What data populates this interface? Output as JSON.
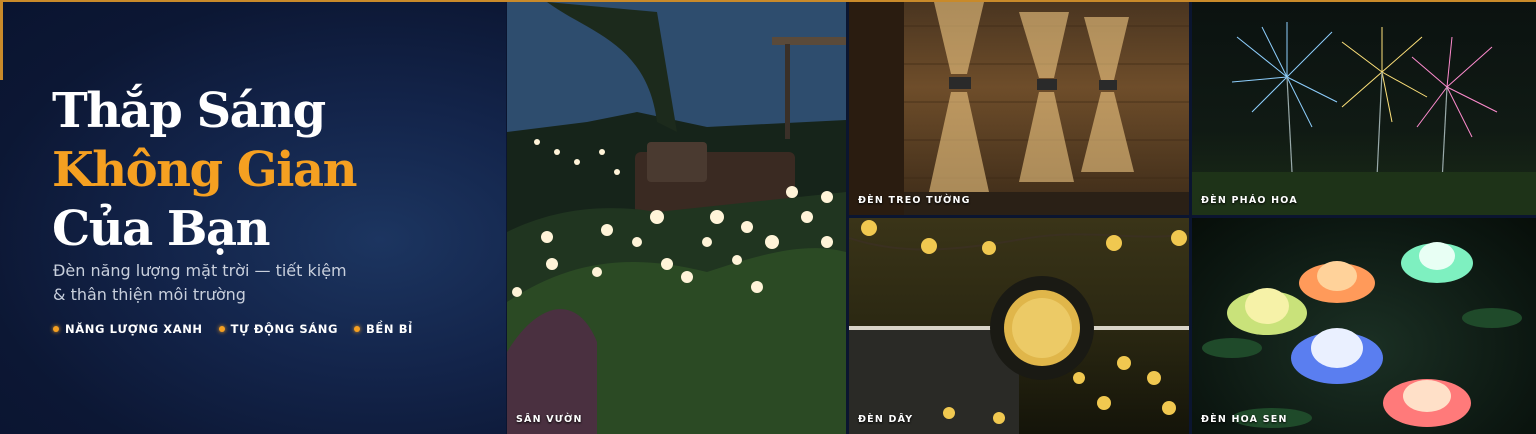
{
  "hero": {
    "headline_line1": "Thắp Sáng",
    "headline_line2": "Không Gian",
    "headline_line3": "Của Bạn",
    "subtitle_line1": "Đèn năng lượng mặt trời — tiết kiệm",
    "subtitle_line2": "& thân thiện môi trường",
    "badges": [
      "NĂNG LƯỢNG XANH",
      "TỰ ĐỘNG SÁNG",
      "BỀN BỈ"
    ]
  },
  "tiles": {
    "garden": "SÂN VƯỜN",
    "wall": "ĐÈN TREO TƯỜNG",
    "fireworks": "ĐÈN PHÁO HOA",
    "string": "ĐÈN DÂY",
    "lotus": "ĐÈN HOA SEN"
  },
  "colors": {
    "accent": "#f5a021",
    "background": "#0b1530",
    "text": "#ffffff"
  }
}
